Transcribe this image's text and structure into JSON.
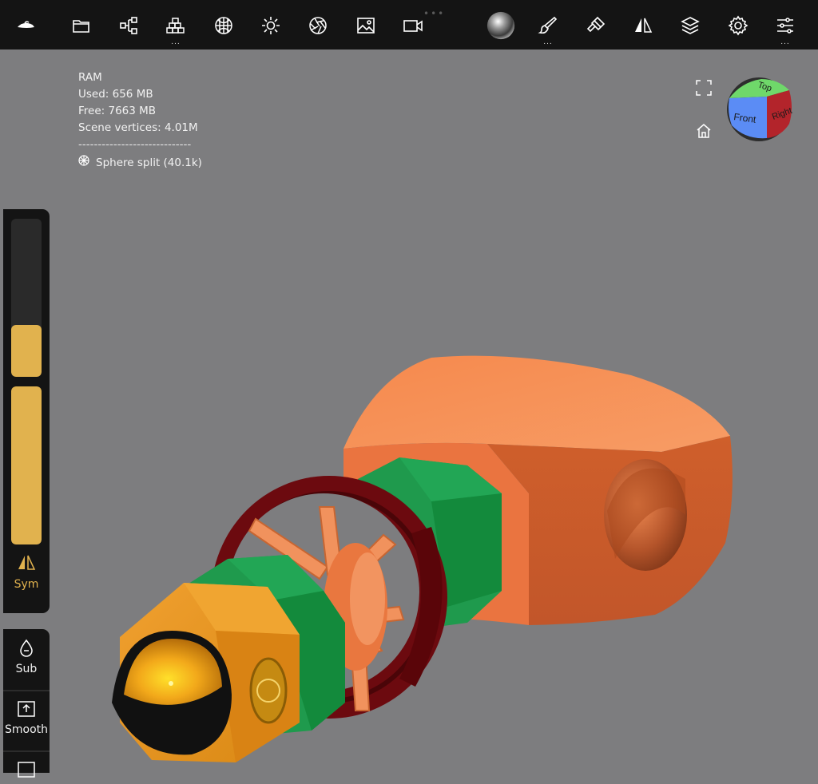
{
  "toolbar": {
    "items": [
      {
        "name": "nomad-logo-icon"
      },
      {
        "name": "folder-icon"
      },
      {
        "name": "scene-tree-icon"
      },
      {
        "name": "topology-icon"
      },
      {
        "name": "material-sphere-icon"
      },
      {
        "name": "light-sun-icon"
      },
      {
        "name": "camera-aperture-icon"
      },
      {
        "name": "image-icon"
      },
      {
        "name": "video-icon"
      },
      {
        "name": "matcap-ball-icon"
      },
      {
        "name": "brush-icon"
      },
      {
        "name": "paint-icon"
      },
      {
        "name": "symmetry-icon"
      },
      {
        "name": "layers-icon"
      },
      {
        "name": "settings-gear-icon"
      },
      {
        "name": "sliders-icon"
      }
    ],
    "more_indicator": "..."
  },
  "stats": {
    "ram": "RAM",
    "used": "Used: 656 MB",
    "free": "Free: 7663 MB",
    "vertices": "Scene vertices: 4.01M",
    "separator": "-----------------------------",
    "tool": "Sphere split (40.1k)"
  },
  "gizmo": {
    "top": "Top",
    "front": "Front",
    "right": "Right",
    "colors": {
      "top": "#6fd86a",
      "front": "#5b8cf5",
      "right": "#b3242b"
    }
  },
  "left_panel": {
    "slider_radius_level": 0.33,
    "slider_intensity_level": 1.0,
    "sym_label": "Sym",
    "sub_label": "Sub",
    "smooth_label": "Smooth"
  },
  "colors": {
    "accent": "#e1b24e",
    "background": "#7d7d7f",
    "toolbar": "#141414"
  }
}
